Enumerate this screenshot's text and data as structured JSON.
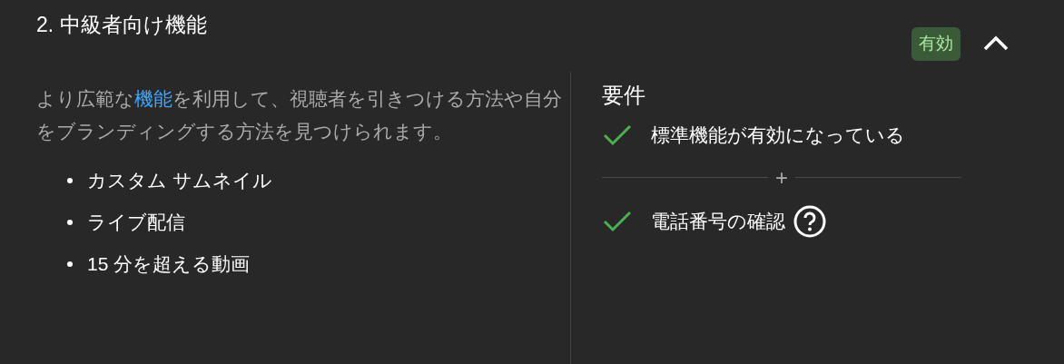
{
  "section": {
    "title": "2. 中級者向け機能",
    "status": {
      "label": "有効",
      "kind": "enabled"
    },
    "expanded": true,
    "description": [
      {
        "kind": "text",
        "text": "より広範な"
      },
      {
        "kind": "link",
        "text": "機能"
      },
      {
        "kind": "text",
        "text": "を利用して、視聴者を引きつける方法や自分をブランディングする方法を見つけられます。"
      }
    ],
    "features": [
      "カスタム サムネイル",
      "ライブ配信",
      "15 分を超える動画"
    ],
    "requirements": {
      "title": "要件",
      "separator": "+",
      "items": [
        {
          "label": "標準機能が有効になっている",
          "met": true,
          "help": false
        },
        {
          "label": "電話番号の確認",
          "met": true,
          "help": true
        }
      ]
    }
  }
}
